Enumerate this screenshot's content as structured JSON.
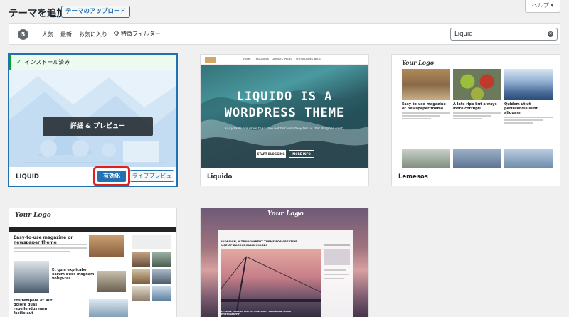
{
  "header": {
    "title": "テーマを追加",
    "upload_button": "テーマのアップロード",
    "help_tab": "ヘルプ ▾"
  },
  "filter_bar": {
    "count": "5",
    "links": [
      "人気",
      "最新",
      "お気に入り"
    ],
    "feature_filter": "特徴フィルター",
    "search_value": "Liquid"
  },
  "themes": [
    {
      "name": "LIQUID",
      "installed_notice": "インストール済み",
      "details_button": "詳細 & プレビュー",
      "activate_button": "有効化",
      "live_preview_button": "ライブプレビュー"
    },
    {
      "name": "Liquido",
      "screenshot": {
        "nav_items": [
          "HOME",
          "FEATURES",
          "LAYOUTS",
          "PAGES",
          "SHORTCODES",
          "BLOG"
        ],
        "title_line1": "LIQUIDO IS A",
        "title_line2": "WORDPRESS THEME",
        "subtitle": "Fairy tales are more than true not because they tell us that dragons exist,",
        "button1": "START BLOGGING",
        "button2": "MORE INFO"
      }
    },
    {
      "name": "Lemesos",
      "screenshot": {
        "logo": "Your Logo",
        "posts": [
          "Easy-to-use magazine or newspaper theme",
          "A late ripe but always more corrupti",
          "Quidem ut ut perferendis sunt aliquam"
        ]
      }
    },
    {
      "name": "",
      "screenshot": {
        "logo": "Your Logo",
        "headline1": "Easy-to-use magazine or newspaper theme",
        "headline2": "Et quia explicabo earum quos magnam volup-tas",
        "headline3": "Eos tempore et Aut dolore quas repellendus nam facilis aut"
      }
    },
    {
      "name": "",
      "screenshot": {
        "logo": "Your Logo",
        "headline": "INDESIGN, A TRANSPARENT THEME FOR CREATIVE USE OF BACKGROUND IMAGES",
        "caption": "LIT SOLE MODERN FIVE OPTION. LIGHT COLOR AND MOOD PHOTOGRAPHY"
      }
    }
  ],
  "colors": {
    "accent": "#2271b1",
    "highlight": "#e02020",
    "installed": "#00a32a"
  }
}
